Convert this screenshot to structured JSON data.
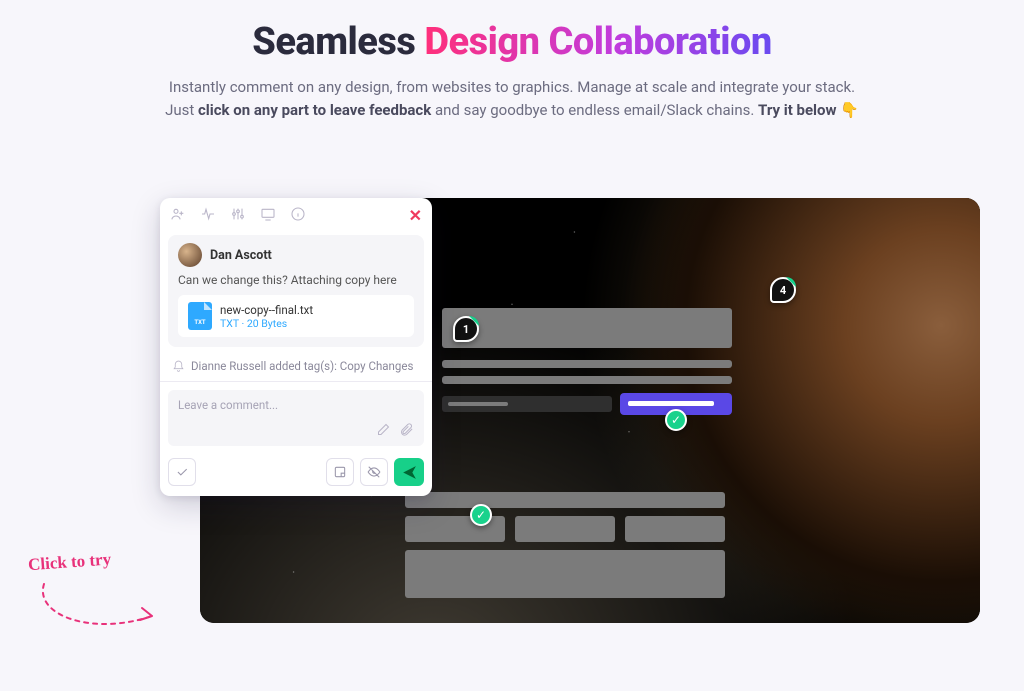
{
  "hero": {
    "title_dark": "Seamless ",
    "title_gradient": "Design Collaboration",
    "subtitle_line1": "Instantly comment on any design, from websites to graphics. Manage at scale and integrate your stack.",
    "subtitle_prefix": "Just ",
    "subtitle_bold1": "click on any part to leave feedback",
    "subtitle_mid": " and say goodbye to endless email/Slack chains. ",
    "subtitle_bold2": "Try it below",
    "hand_emoji": "👇"
  },
  "pins": {
    "pin1": "1",
    "pin4": "4"
  },
  "panel": {
    "author": "Dan Ascott",
    "comment": "Can we change this? Attaching copy here",
    "attachment": {
      "name": "new-copy--final.txt",
      "meta": "TXT · 20 Bytes"
    },
    "activity": "Dianne Russell added tag(s): Copy Changes",
    "input_placeholder": "Leave a comment..."
  },
  "cta": {
    "label": "Click to try"
  }
}
